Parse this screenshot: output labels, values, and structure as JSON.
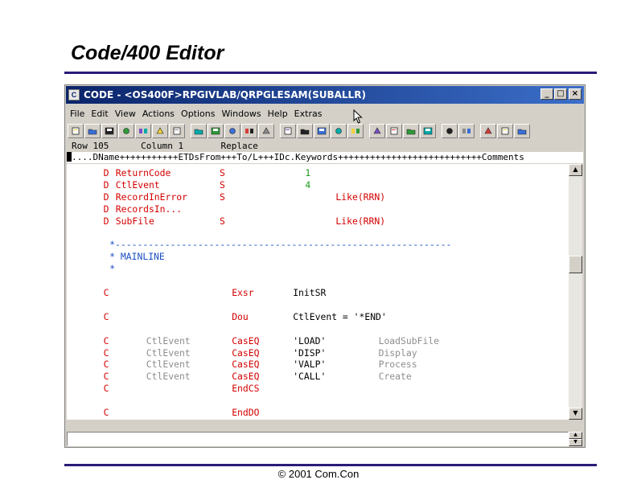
{
  "slide": {
    "title": "Code/400 Editor",
    "footer": "© 2001 Com.Con"
  },
  "window": {
    "title": "CODE - <OS400F>RPGIVLAB/QRPGLESAM(SUBALLR)",
    "menu": [
      "File",
      "Edit",
      "View",
      "Actions",
      "Options",
      "Windows",
      "Help",
      "Extras"
    ],
    "status": {
      "row_label": "Row",
      "row": "105",
      "column_label": "Column",
      "column": "1",
      "mode": "Replace"
    },
    "ruler": "....DName+++++++++++ETDsFrom+++To/L+++IDc.Keywords+++++++++++++++++++++++++++Comments"
  },
  "colors": {
    "spec": "#d40000",
    "name": "#d40000",
    "type": "#d40000",
    "length": "#1e9a1e",
    "keyword": "#d40000",
    "comment": "#1a4ec4",
    "factor1": "#8e8e8e",
    "opcode": "#d40000",
    "factor2": "#000000",
    "result": "#8e8e8e",
    "title_bar": "#0a246a",
    "rule": "#2b1a78"
  },
  "code": [
    {
      "row": 0,
      "segs": [
        {
          "col": 6,
          "text": "D",
          "role": "spec"
        },
        {
          "col": 8,
          "text": "ReturnCode",
          "role": "name"
        },
        {
          "col": 25,
          "text": "S",
          "role": "type"
        },
        {
          "col": 39,
          "text": "1",
          "role": "length"
        }
      ]
    },
    {
      "row": 1,
      "segs": [
        {
          "col": 6,
          "text": "D",
          "role": "spec"
        },
        {
          "col": 8,
          "text": "CtlEvent",
          "role": "name"
        },
        {
          "col": 25,
          "text": "S",
          "role": "type"
        },
        {
          "col": 39,
          "text": "4",
          "role": "length"
        }
      ]
    },
    {
      "row": 2,
      "segs": [
        {
          "col": 6,
          "text": "D",
          "role": "spec"
        },
        {
          "col": 8,
          "text": "RecordInError",
          "role": "name"
        },
        {
          "col": 25,
          "text": "S",
          "role": "type"
        },
        {
          "col": 44,
          "text": "Like(RRN)",
          "role": "keyword"
        }
      ]
    },
    {
      "row": 3,
      "segs": [
        {
          "col": 6,
          "text": "D",
          "role": "spec"
        },
        {
          "col": 8,
          "text": "RecordsIn...",
          "role": "name"
        }
      ]
    },
    {
      "row": 4,
      "segs": [
        {
          "col": 6,
          "text": "D",
          "role": "spec"
        },
        {
          "col": 8,
          "text": "SubFile",
          "role": "name"
        },
        {
          "col": 25,
          "text": "S",
          "role": "type"
        },
        {
          "col": 44,
          "text": "Like(RRN)",
          "role": "keyword"
        }
      ]
    },
    {
      "row": 6,
      "segs": [
        {
          "col": 7,
          "text": "*-------------------------------------------------------------",
          "role": "comment"
        }
      ]
    },
    {
      "row": 7,
      "segs": [
        {
          "col": 7,
          "text": "* MAINLINE",
          "role": "comment"
        }
      ]
    },
    {
      "row": 8,
      "segs": [
        {
          "col": 7,
          "text": "*",
          "role": "comment"
        }
      ]
    },
    {
      "row": 10,
      "segs": [
        {
          "col": 6,
          "text": "C",
          "role": "spec"
        },
        {
          "col": 27,
          "text": "Exsr",
          "role": "opcode"
        },
        {
          "col": 37,
          "text": "InitSR",
          "role": "factor2"
        }
      ]
    },
    {
      "row": 12,
      "segs": [
        {
          "col": 6,
          "text": "C",
          "role": "spec"
        },
        {
          "col": 27,
          "text": "Dou",
          "role": "opcode"
        },
        {
          "col": 37,
          "text": "CtlEvent = '*END'",
          "role": "factor2"
        }
      ]
    },
    {
      "row": 14,
      "segs": [
        {
          "col": 6,
          "text": "C",
          "role": "spec"
        },
        {
          "col": 13,
          "text": "CtlEvent",
          "role": "factor1"
        },
        {
          "col": 27,
          "text": "CasEQ",
          "role": "opcode"
        },
        {
          "col": 37,
          "text": "'LOAD'",
          "role": "factor2"
        },
        {
          "col": 51,
          "text": "LoadSubFile",
          "role": "result"
        }
      ]
    },
    {
      "row": 15,
      "segs": [
        {
          "col": 6,
          "text": "C",
          "role": "spec"
        },
        {
          "col": 13,
          "text": "CtlEvent",
          "role": "factor1"
        },
        {
          "col": 27,
          "text": "CasEQ",
          "role": "opcode"
        },
        {
          "col": 37,
          "text": "'DISP'",
          "role": "factor2"
        },
        {
          "col": 51,
          "text": "Display",
          "role": "result"
        }
      ]
    },
    {
      "row": 16,
      "segs": [
        {
          "col": 6,
          "text": "C",
          "role": "spec"
        },
        {
          "col": 13,
          "text": "CtlEvent",
          "role": "factor1"
        },
        {
          "col": 27,
          "text": "CasEQ",
          "role": "opcode"
        },
        {
          "col": 37,
          "text": "'VALP'",
          "role": "factor2"
        },
        {
          "col": 51,
          "text": "Process",
          "role": "result"
        }
      ]
    },
    {
      "row": 17,
      "segs": [
        {
          "col": 6,
          "text": "C",
          "role": "spec"
        },
        {
          "col": 13,
          "text": "CtlEvent",
          "role": "factor1"
        },
        {
          "col": 27,
          "text": "CasEQ",
          "role": "opcode"
        },
        {
          "col": 37,
          "text": "'CALL'",
          "role": "factor2"
        },
        {
          "col": 51,
          "text": "Create",
          "role": "result"
        }
      ]
    },
    {
      "row": 18,
      "segs": [
        {
          "col": 6,
          "text": "C",
          "role": "spec"
        },
        {
          "col": 27,
          "text": "EndCS",
          "role": "opcode"
        }
      ]
    },
    {
      "row": 20,
      "segs": [
        {
          "col": 6,
          "text": "C",
          "role": "spec"
        },
        {
          "col": 27,
          "text": "EndDO",
          "role": "opcode"
        }
      ]
    }
  ],
  "toolbar_icons": [
    "new-file-icon",
    "open-folder-icon",
    "save-icon",
    "print-icon",
    "cut-icon",
    "copy-icon",
    "paste-icon",
    "undo-icon",
    "redo-icon",
    "select-icon",
    "find-icon",
    "ruler-icon",
    "run-icon",
    "compile-icon",
    "debug-icon",
    "build-icon",
    "help-icon",
    "stop-icon",
    "grid-icon",
    "export-icon",
    "play-icon",
    "font-icon",
    "format-icon",
    "layout-icon",
    "split-icon",
    "tile-icon"
  ]
}
